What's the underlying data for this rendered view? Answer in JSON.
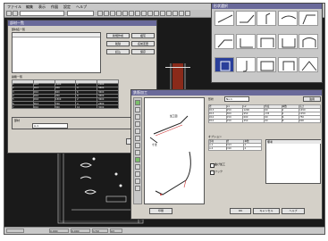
{
  "app": {
    "menu": [
      "ファイル",
      "編集",
      "表示",
      "作図",
      "設定",
      "ヘルプ"
    ],
    "status": [
      "0.000",
      "0.000",
      "1:50",
      "A3"
    ]
  },
  "list_window": {
    "title": "部材一覧",
    "section1": "部材名一覧",
    "section2": "鉄筋一覧",
    "buttons": [
      "新規作成",
      "複写",
      "削除",
      "名前変更",
      "読込",
      "保存"
    ],
    "bottom_label": "部材",
    "bottom_field": "A-1",
    "ok": "閉じる",
    "rows": [
      [
        "1",
        "D13",
        "1200",
        "2",
        "2400"
      ],
      [
        "2",
        "D13",
        "950",
        "4",
        "3800"
      ],
      [
        "3",
        "D10",
        "600",
        "6",
        "3600"
      ],
      [
        "4",
        "D10",
        "450",
        "8",
        "3600"
      ],
      [
        "5",
        "D16",
        "1800",
        "2",
        "3600"
      ],
      [
        "6",
        "D13",
        "700",
        "4",
        "2800"
      ],
      [
        "7",
        "D10",
        "300",
        "10",
        "3000"
      ]
    ]
  },
  "edit_window": {
    "title": "鉄筋加工",
    "combo_label": "形状",
    "combo_value": "No.1",
    "apply": "適用",
    "table_header": [
      "径",
      "L1",
      "L2",
      "角度",
      "本数",
      "長さ"
    ],
    "table_rows": [
      [
        "D13",
        "250",
        "1200",
        "90",
        "2",
        "1450"
      ],
      [
        "D13",
        "300",
        "950",
        "135",
        "4",
        "1250"
      ],
      [
        "D10",
        "150",
        "600",
        "90",
        "6",
        "750"
      ],
      [
        "D10",
        "150",
        "450",
        "90",
        "8",
        "600"
      ]
    ],
    "sub_header": [
      "部材",
      "径",
      "本数"
    ],
    "sub_rows": [
      [
        "A-1",
        "D13",
        "2"
      ],
      [
        "A-2",
        "D10",
        "4"
      ]
    ],
    "options_title": "オプション",
    "opt1": "曲げ加工",
    "opt2": "フック",
    "note_title": "備考",
    "preview_label": "加工図",
    "dim_label": "寸法",
    "ok": "OK",
    "cancel": "キャンセル",
    "help": "ヘルプ",
    "print": "印刷"
  },
  "palette_window": {
    "title": "形状選択"
  }
}
